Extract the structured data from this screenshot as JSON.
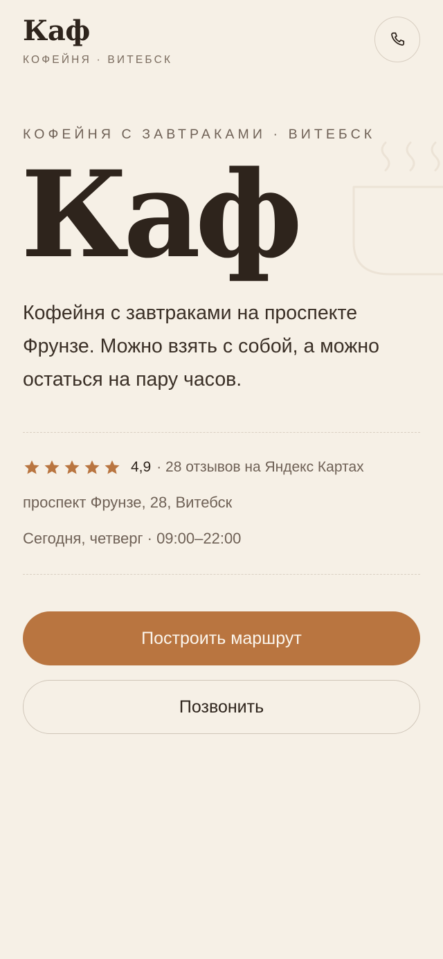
{
  "header": {
    "logo": "Каф",
    "subtitle": "КОФЕЙНЯ · ВИТЕБСК",
    "call_icon": "phone-icon"
  },
  "hero": {
    "eyebrow": "КОФЕЙНЯ С ЗАВТРАКАМИ · ВИТЕБСК",
    "title": "Каф",
    "description": "Кофейня с завтраками на проспекте Фрунзе. Можно взять с собой, а можно остаться на пару часов.",
    "decoration_icon": "coffee-cup-icon"
  },
  "info": {
    "stars": 5,
    "rating": "4,9",
    "reviews": "· 28 отзывов на Яндекс Картах",
    "address": "проспект Фрунзе, 28, Витебск",
    "hours": "Сегодня, четверг · 09:00–22:00"
  },
  "actions": {
    "route_label": "Построить маршрут",
    "call_label": "Позвонить"
  },
  "colors": {
    "background": "#f6f0e6",
    "accent": "#b97540",
    "text": "#2e241c",
    "muted": "#6f6156"
  }
}
